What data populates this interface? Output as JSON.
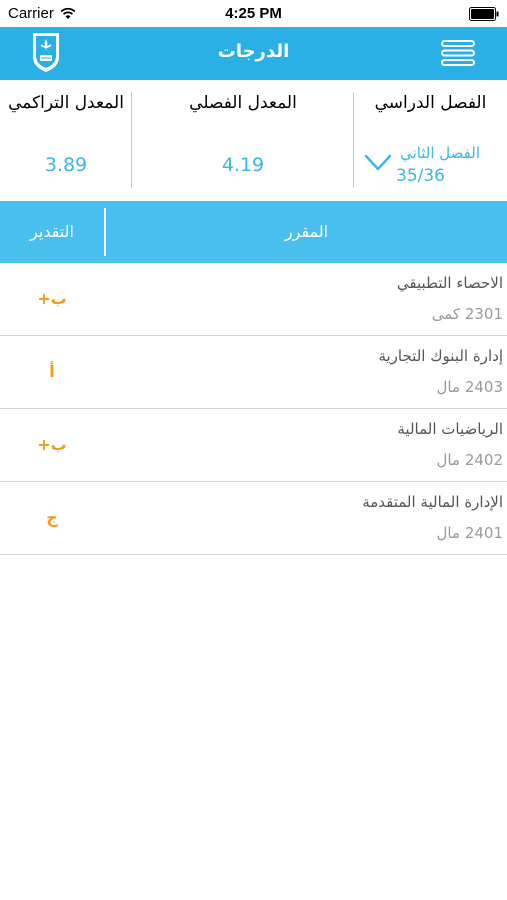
{
  "status_bar": {
    "carrier": "Carrier",
    "time": "4:25 PM"
  },
  "nav": {
    "title": "الدرجات",
    "logo_icon": "university-logo-icon",
    "menu_icon": "hamburger-menu-icon"
  },
  "summary": {
    "term_label": "الفصل الدراسي",
    "term_value": "الفصل الثاني",
    "term_count": "35/36",
    "gpa_term_label": "المعدل الفصلي",
    "gpa_term_value": "4.19",
    "gpa_cum_label": "المعدل التراكمي",
    "gpa_cum_value": "3.89"
  },
  "table": {
    "header_course": "المقرر",
    "header_grade": "التقدير",
    "rows": [
      {
        "name": "الاحصاء التطبيقي",
        "code": "2301 كمى",
        "grade": "ب+"
      },
      {
        "name": "إدارة البنوك التجارية",
        "code": "2403 مال",
        "grade": "أ"
      },
      {
        "name": "الرياضيات المالية",
        "code": "2402 مال",
        "grade": "ب+"
      },
      {
        "name": "الإدارة المالية المتقدمة",
        "code": "2401 مال",
        "grade": "ج"
      }
    ]
  },
  "colors": {
    "nav_bg": "#2bb0e6",
    "table_header_bg": "#49bfee",
    "accent_value": "#3bb6e8",
    "grade_orange": "#f59a1d"
  }
}
